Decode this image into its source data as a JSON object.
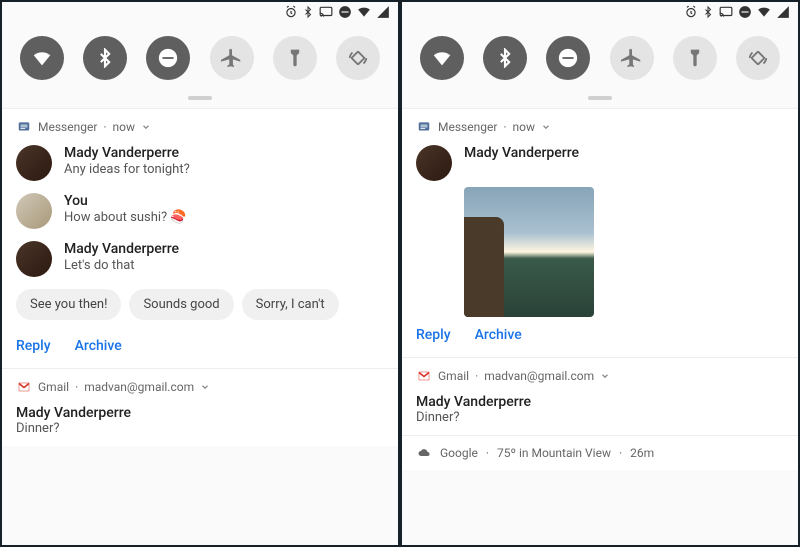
{
  "status_icons": [
    "alarm",
    "bluetooth",
    "cast",
    "dnd",
    "wifi",
    "signal"
  ],
  "qs": [
    {
      "name": "wifi",
      "on": true
    },
    {
      "name": "bluetooth",
      "on": true
    },
    {
      "name": "dnd",
      "on": true
    },
    {
      "name": "airplane",
      "on": false
    },
    {
      "name": "flashlight",
      "on": false
    },
    {
      "name": "rotate",
      "on": false
    }
  ],
  "left": {
    "messenger": {
      "app": "Messenger",
      "time": "now",
      "thread": [
        {
          "name": "Mady Vanderperre",
          "text": "Any ideas for tonight?",
          "avatar": "a1"
        },
        {
          "name": "You",
          "text": "How about sushi? 🍣",
          "avatar": "a2"
        },
        {
          "name": "Mady Vanderperre",
          "text": "Let's do that",
          "avatar": "a1"
        }
      ],
      "suggestions": [
        "See you then!",
        "Sounds good",
        "Sorry, I can't"
      ],
      "actions": {
        "reply": "Reply",
        "archive": "Archive"
      }
    },
    "gmail": {
      "app": "Gmail",
      "email": "madvan@gmail.com",
      "subject": "Mady Vanderperre",
      "body": "Dinner?"
    }
  },
  "right": {
    "messenger": {
      "app": "Messenger",
      "time": "now",
      "sender": "Mady Vanderperre",
      "actions": {
        "reply": "Reply",
        "archive": "Archive"
      }
    },
    "gmail": {
      "app": "Gmail",
      "email": "madvan@gmail.com",
      "subject": "Mady Vanderperre",
      "body": "Dinner?"
    },
    "weather": {
      "source": "Google",
      "text": "75º in Mountain View",
      "age": "26m"
    }
  }
}
